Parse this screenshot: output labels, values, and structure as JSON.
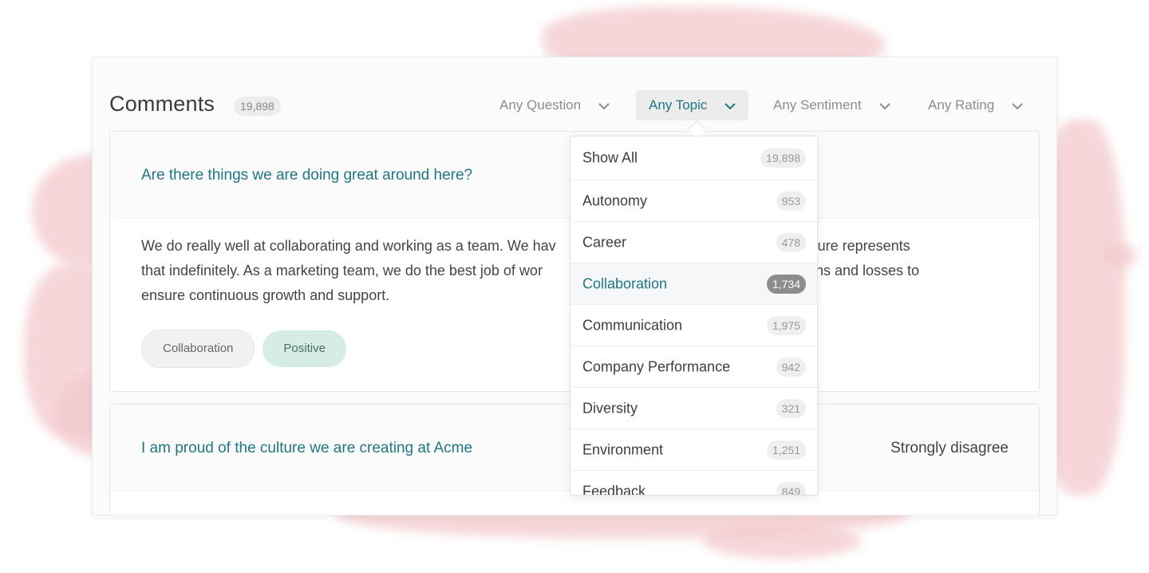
{
  "header": {
    "title": "Comments",
    "total_count": "19,898",
    "filters": [
      {
        "label": "Any Question"
      },
      {
        "label": "Any Topic"
      },
      {
        "label": "Any Sentiment"
      },
      {
        "label": "Any Rating"
      }
    ]
  },
  "cards": [
    {
      "question": "Are there things we are doing great around here?",
      "comment_left_1": "We do really well at collaborating and working as a team. We hav",
      "comment_right_1": "culture represents",
      "comment_left_2": "that indefinitely. As a marketing team, we do the best job of wor",
      "comment_right_2": "he wins and losses to",
      "comment_line_3": "ensure continuous growth and support.",
      "tags": {
        "topic": "Collaboration",
        "sentiment": "Positive"
      }
    },
    {
      "question": "I am proud of the culture we are creating at Acme",
      "rating": "Strongly disagree"
    }
  ],
  "topic_dropdown": {
    "selected": "Collaboration",
    "options": [
      {
        "label": "Show All",
        "count": "19,898"
      },
      {
        "label": "Autonomy",
        "count": "953"
      },
      {
        "label": "Career",
        "count": "478"
      },
      {
        "label": "Collaboration",
        "count": "1,734"
      },
      {
        "label": "Communication",
        "count": "1,975"
      },
      {
        "label": "Company Performance",
        "count": "942"
      },
      {
        "label": "Diversity",
        "count": "321"
      },
      {
        "label": "Environment",
        "count": "1,251"
      },
      {
        "label": "Feedback",
        "count": "849"
      }
    ]
  },
  "colors": {
    "accent": "#1d7886",
    "sentiment_positive_bg": "#d6ece6",
    "backdrop_wash": "#f3c9cd"
  },
  "icons": {
    "filter_chevron": "chevron-down-icon"
  }
}
